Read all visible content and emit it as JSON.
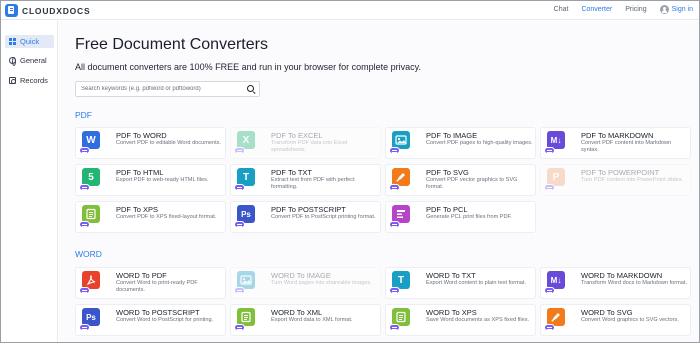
{
  "header": {
    "logo_text": "CLOUDXDOCS",
    "nav": [
      {
        "label": "Chat"
      },
      {
        "label": "Converter"
      },
      {
        "label": "Pricing"
      }
    ],
    "signin_label": "Sign in",
    "active_nav": "Converter"
  },
  "sidebar": {
    "items": [
      {
        "label": "Quick",
        "icon": "grid-icon"
      },
      {
        "label": "General",
        "icon": "globe-icon"
      },
      {
        "label": "Records",
        "icon": "records-icon"
      }
    ]
  },
  "main": {
    "title": "Free Document Converters",
    "subtitle": "All document converters are 100% FREE and run in your browser for complete privacy.",
    "search_placeholder": "Search keywords (e.g. pdfword or pdftoword)"
  },
  "sections": {
    "pdf": {
      "label": "PDF",
      "cards": [
        {
          "name": "PDF To WORD",
          "desc": "Convert PDF to editable Word documents.",
          "icon": "word-icon",
          "glyph": "W",
          "color": "#2f6de1",
          "enabled": true
        },
        {
          "name": "PDF To EXCEL",
          "desc": "Transform PDF data into Excel spreadsheets.",
          "icon": "excel-icon",
          "glyph": "X",
          "color": "#22b573",
          "enabled": false
        },
        {
          "name": "PDF To IMAGE",
          "desc": "Convert PDF pages to high-quality images.",
          "icon": "image-icon",
          "glyph": "",
          "color": "#1a9fc4",
          "enabled": true
        },
        {
          "name": "PDF To MARKDOWN",
          "desc": "Convert PDF content into Markdown syntax.",
          "icon": "markdown-icon",
          "glyph": "M↓",
          "color": "#6a4bd8",
          "enabled": true
        },
        {
          "name": "PDF To HTML",
          "desc": "Export PDF to web-ready HTML files.",
          "icon": "html-icon",
          "glyph": "5",
          "color": "#22b573",
          "enabled": true
        },
        {
          "name": "PDF To TXT",
          "desc": "Extract text from PDF with perfect formatting.",
          "icon": "txt-icon",
          "glyph": "T",
          "color": "#1a9fc4",
          "enabled": true
        },
        {
          "name": "PDF To SVG",
          "desc": "Convert PDF vector graphics to SVG format.",
          "icon": "svg-icon",
          "glyph": "",
          "color": "#f27a1a",
          "enabled": true
        },
        {
          "name": "PDF To POWERPOINT",
          "desc": "Turn PDF content into PowerPoint slides.",
          "icon": "powerpoint-icon",
          "glyph": "P",
          "color": "#f3a77a",
          "enabled": false
        },
        {
          "name": "PDF To XPS",
          "desc": "Convert PDF to XPS fixed-layout format.",
          "icon": "xps-icon",
          "glyph": "",
          "color": "#7fbf3a",
          "enabled": true
        },
        {
          "name": "PDF To POSTSCRIPT",
          "desc": "Convert PDF to PostScript printing format.",
          "icon": "postscript-icon",
          "glyph": "Ps",
          "color": "#3a56c9",
          "enabled": true
        },
        {
          "name": "PDF To PCL",
          "desc": "Generate PCL print files from PDF.",
          "icon": "pcl-icon",
          "glyph": "",
          "color": "#b544c9",
          "enabled": true
        }
      ]
    },
    "word": {
      "label": "WORD",
      "cards": [
        {
          "name": "WORD To PDF",
          "desc": "Convert Word to print-ready PDF documents.",
          "icon": "pdf-icon",
          "glyph": "",
          "color": "#e8412c",
          "enabled": true
        },
        {
          "name": "WORD To IMAGE",
          "desc": "Turn Word pages into shareable images.",
          "icon": "image-icon",
          "glyph": "",
          "color": "#1a9fc4",
          "enabled": false
        },
        {
          "name": "WORD To TXT",
          "desc": "Export Word content to plain text format.",
          "icon": "txt-icon",
          "glyph": "T",
          "color": "#1a9fc4",
          "enabled": true
        },
        {
          "name": "WORD To MARKDOWN",
          "desc": "Transform Word docs to Markdown format.",
          "icon": "markdown-icon",
          "glyph": "M↓",
          "color": "#6a4bd8",
          "enabled": true
        },
        {
          "name": "WORD To POSTSCRIPT",
          "desc": "Convert Word to PostScript for printing.",
          "icon": "postscript-icon",
          "glyph": "Ps",
          "color": "#3a56c9",
          "enabled": true
        },
        {
          "name": "WORD To XML",
          "desc": "Export Word data to XML format.",
          "icon": "xml-icon",
          "glyph": "",
          "color": "#7fbf3a",
          "enabled": true
        },
        {
          "name": "WORD To XPS",
          "desc": "Save Word documents as XPS fixed files.",
          "icon": "xps-icon",
          "glyph": "",
          "color": "#7fbf3a",
          "enabled": true
        },
        {
          "name": "WORD To SVG",
          "desc": "Convert Word graphics to SVG vectors.",
          "icon": "svg-icon",
          "glyph": "",
          "color": "#f27a1a",
          "enabled": true
        }
      ]
    }
  }
}
